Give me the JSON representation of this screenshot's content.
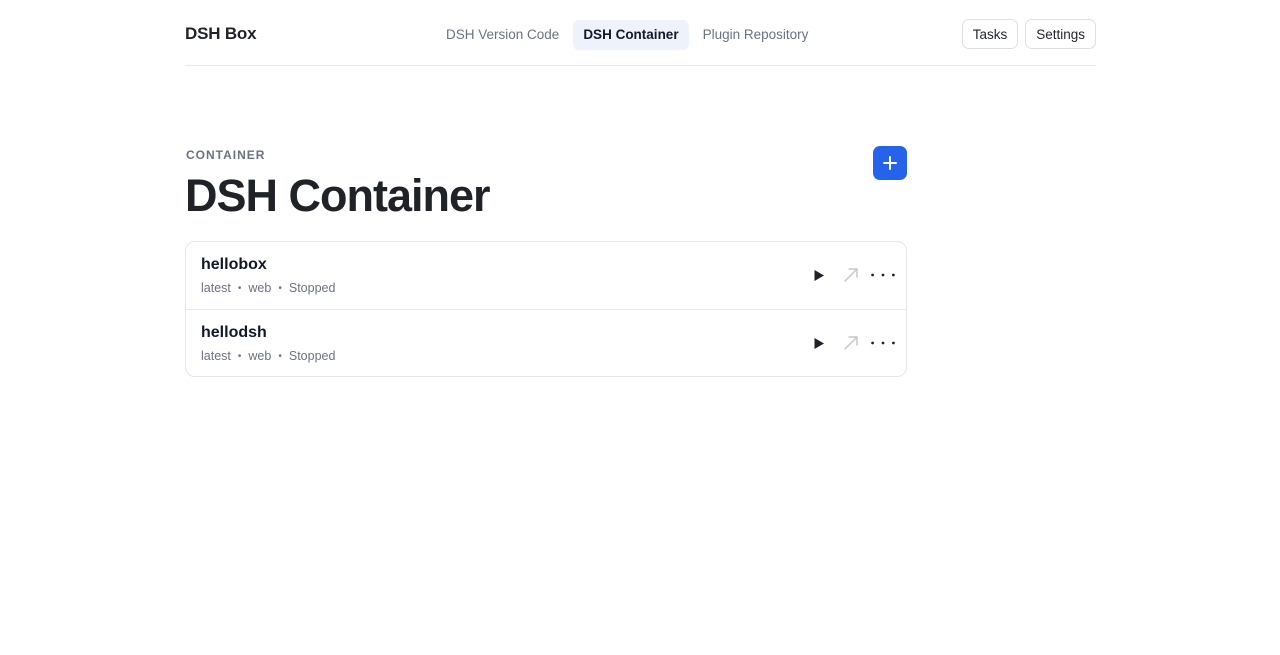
{
  "header": {
    "brand": "DSH Box",
    "tabs": [
      {
        "label": "DSH Version Code",
        "active": false
      },
      {
        "label": "DSH Container",
        "active": true
      },
      {
        "label": "Plugin Repository",
        "active": false
      }
    ],
    "actions": {
      "tasks_label": "Tasks",
      "settings_label": "Settings"
    }
  },
  "main": {
    "eyebrow": "CONTAINER",
    "title": "DSH Container",
    "add_icon": "plus-icon",
    "containers": [
      {
        "name": "hellobox",
        "version": "latest",
        "type": "web",
        "status": "Stopped"
      },
      {
        "name": "hellodsh",
        "version": "latest",
        "type": "web",
        "status": "Stopped"
      }
    ],
    "row_icons": [
      "play-icon",
      "open-external-icon",
      "more-icon"
    ],
    "separator": "•"
  },
  "colors": {
    "accent": "#2563eb",
    "active_tab_bg": "#edf2fb",
    "muted_text": "#6b7280",
    "border": "#e3e6ea"
  }
}
